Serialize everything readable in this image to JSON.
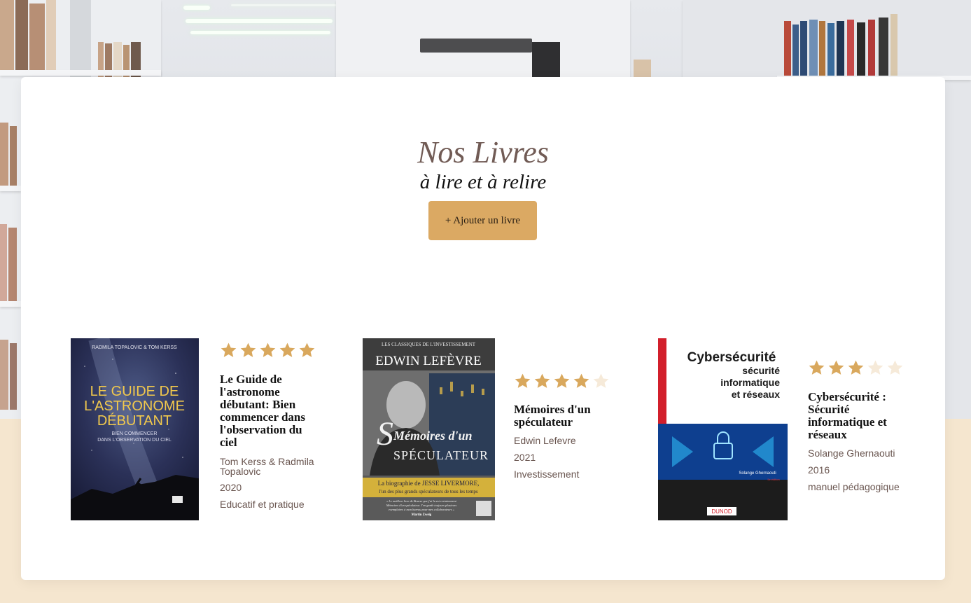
{
  "header": {
    "title": "Nos Livres",
    "subtitle": "à lire et à relire",
    "add_button_label": "+ Ajouter un livre"
  },
  "colors": {
    "accent": "#dba963",
    "title": "#715b55",
    "star_filled": "#d9a85d",
    "star_empty": "#f6ead9",
    "page_bg": "#f5e6cf"
  },
  "books": [
    {
      "title": "Le Guide de l'astronome débutant: Bien commencer dans l'observation du ciel",
      "title_lines": [
        "Le Guide de",
        "l'astronome",
        "débutant: Bien",
        "commencer dans",
        "l'observation du",
        "ciel"
      ],
      "author": "Tom Kerss & Radmila Topalovic",
      "author_lines": [
        "Tom Kerss & Radmila",
        "Topalovic"
      ],
      "year": "2020",
      "category": "Educatif et pratique",
      "rating": 5,
      "cover": {
        "top_text": "RADMILA TOPALOVIC & TOM KERSS",
        "title_lines": [
          "LE GUIDE DE",
          "L'ASTRONOME",
          "DÉBUTANT"
        ],
        "subtitle_lines": [
          "BIEN COMMENCER",
          "DANS L'OBSERVATION DU CIEL"
        ]
      }
    },
    {
      "title": "Mémoires d'un spéculateur",
      "title_lines": [
        "Mémoires d'un",
        "spéculateur"
      ],
      "author": "Edwin Lefevre",
      "author_lines": [
        "Edwin Lefevre"
      ],
      "year": "2021",
      "category": "Investissement",
      "rating": 4,
      "cover": {
        "series": "LES CLASSIQUES DE L'INVESTISSEMENT",
        "author": "EDWIN LEFÈVRE",
        "title_line1": "Mémoires d'un",
        "title_line2": "SPÉCULATEUR",
        "band_lines": [
          "La biographie de JESSE LIVERMORE,",
          "l'un des plus grands spéculateurs de tous les temps"
        ],
        "quote_lines": [
          "« Le meilleur livre de Bourse que j'ai lu est certainement",
          "Mémoires d'un spéculateur. J'en garde toujours plusieurs",
          "exemplaires à mon bureau pour mes collaborateurs »",
          "Martin Zweig"
        ]
      }
    },
    {
      "title": "Cybersécurité : Sécurité informatique et réseaux",
      "title_lines": [
        "Cybersécurité :",
        "Sécurité",
        "informatique et",
        "réseaux"
      ],
      "author": "Solange Ghernaouti",
      "author_lines": [
        "Solange Ghernaouti"
      ],
      "year": "2016",
      "category": "manuel pédagogique",
      "rating": 3,
      "cover": {
        "title": "Cybersécurité",
        "subtitle_lines": [
          "sécurité",
          "informatique",
          "et réseaux"
        ],
        "author": "Solange Ghernaouti",
        "publisher": "DUNOD",
        "edition": "5e édition"
      }
    }
  ]
}
